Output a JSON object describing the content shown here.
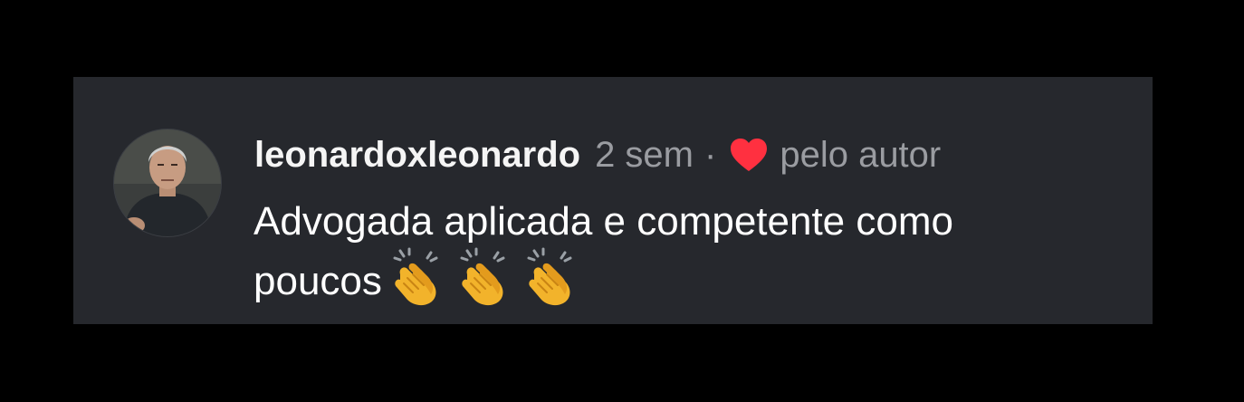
{
  "comment": {
    "username": "leonardoxleonardo",
    "time": "2 sem",
    "separator": "·",
    "liked_label": "pelo autor",
    "text_line1": "Advogada aplicada e competente como",
    "text_line2": "poucos",
    "emojis": [
      "clapping-hands",
      "clapping-hands",
      "clapping-hands"
    ]
  },
  "colors": {
    "background": "#000000",
    "card": "#26282d",
    "username": "#f5f5f5",
    "meta": "#9a9ca1",
    "heart": "#ff3040",
    "text": "#ffffff"
  }
}
